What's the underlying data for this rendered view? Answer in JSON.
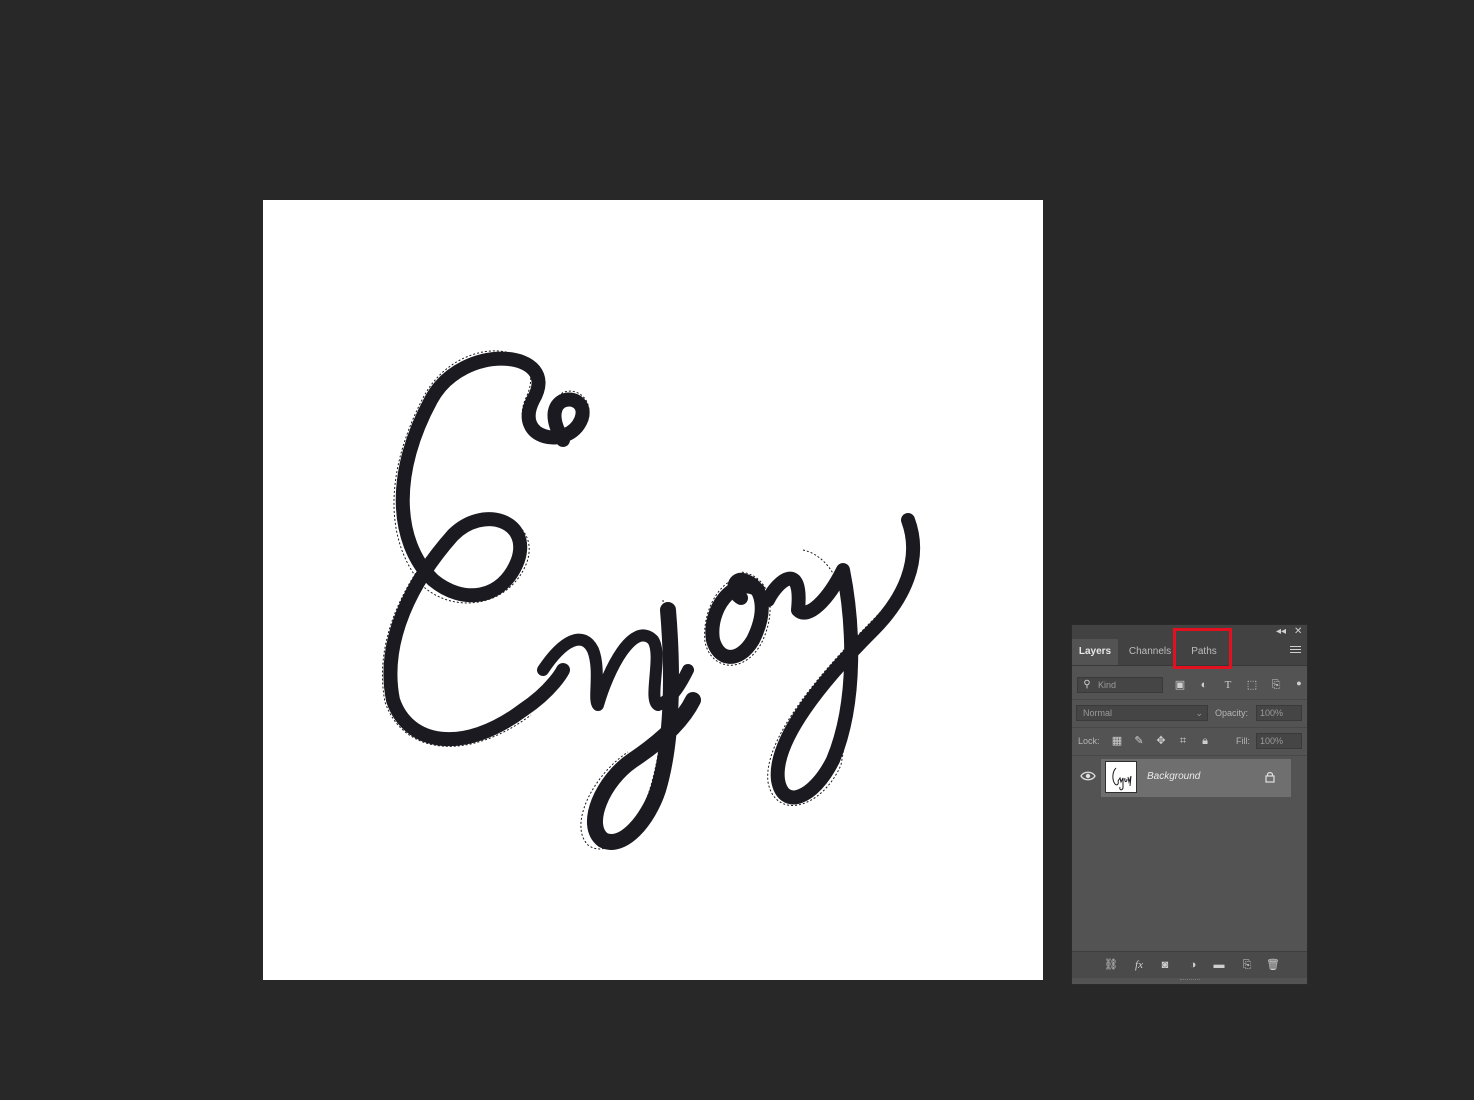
{
  "canvas": {
    "background": "#ffffff",
    "ink_color": "#1b1a20"
  },
  "layers_panel": {
    "tabs": [
      {
        "label": "Layers",
        "active": true
      },
      {
        "label": "Channels",
        "active": false
      },
      {
        "label": "Paths",
        "active": false,
        "highlighted": true
      }
    ],
    "filter": {
      "placeholder": "Kind"
    },
    "blend_mode": "Normal",
    "opacity_label": "Opacity:",
    "opacity_value": "100%",
    "lock_label": "Lock:",
    "fill_label": "Fill:",
    "fill_value": "100%",
    "layers": [
      {
        "name": "Background",
        "visible": true,
        "locked": true,
        "thumb_text": "Enjoy"
      }
    ]
  },
  "colors": {
    "workspace": "#282828",
    "panel": "#535353",
    "highlight": "#e3101f"
  }
}
